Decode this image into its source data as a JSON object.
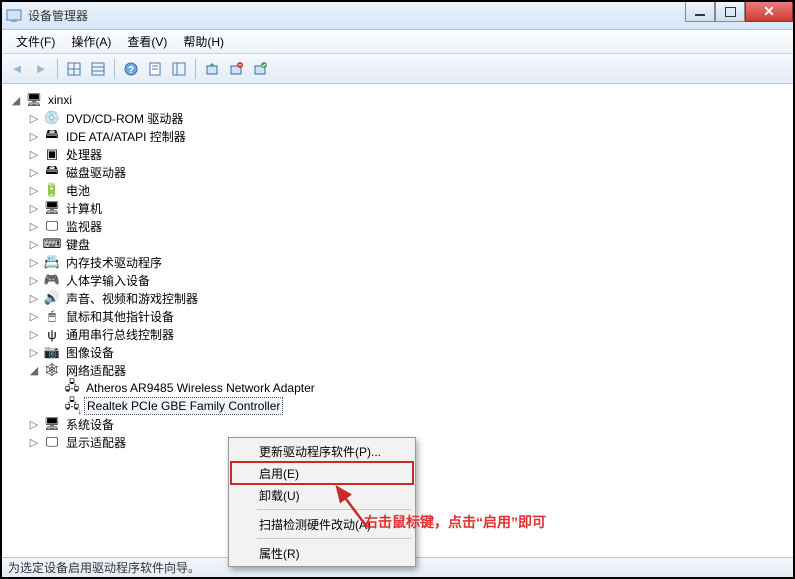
{
  "window": {
    "title": "设备管理器"
  },
  "menus": [
    {
      "label": "文件(F)"
    },
    {
      "label": "操作(A)"
    },
    {
      "label": "查看(V)"
    },
    {
      "label": "帮助(H)"
    }
  ],
  "root": {
    "name": "xinxi"
  },
  "categories": [
    {
      "label": "DVD/CD-ROM 驱动器",
      "icon": "💿",
      "expandable": true
    },
    {
      "label": "IDE ATA/ATAPI 控制器",
      "icon": "🖴",
      "expandable": true
    },
    {
      "label": "处理器",
      "icon": "▣",
      "expandable": true
    },
    {
      "label": "磁盘驱动器",
      "icon": "🖴",
      "expandable": true
    },
    {
      "label": "电池",
      "icon": "🔋",
      "expandable": true
    },
    {
      "label": "计算机",
      "icon": "🖥",
      "expandable": true
    },
    {
      "label": "监视器",
      "icon": "🖵",
      "expandable": true
    },
    {
      "label": "键盘",
      "icon": "⌨",
      "expandable": true
    },
    {
      "label": "内存技术驱动程序",
      "icon": "📇",
      "expandable": true
    },
    {
      "label": "人体学输入设备",
      "icon": "🎮",
      "expandable": true
    },
    {
      "label": "声音、视频和游戏控制器",
      "icon": "🔊",
      "expandable": true
    },
    {
      "label": "鼠标和其他指针设备",
      "icon": "🖱",
      "expandable": true
    },
    {
      "label": "通用串行总线控制器",
      "icon": "ψ",
      "expandable": true
    },
    {
      "label": "图像设备",
      "icon": "📷",
      "expandable": true
    }
  ],
  "network": {
    "label": "网络适配器",
    "icon": "🕸",
    "children": [
      {
        "label": "Atheros AR9485 Wireless Network Adapter",
        "icon": "🖧"
      },
      {
        "label": "Realtek PCIe GBE Family Controller",
        "icon": "🖧",
        "selected": true,
        "disabled": true
      }
    ]
  },
  "tail_categories": [
    {
      "label": "系统设备",
      "icon": "🖥",
      "expandable": true
    },
    {
      "label": "显示适配器",
      "icon": "🖵",
      "expandable": true
    }
  ],
  "context_menu": [
    {
      "label": "更新驱动程序软件(P)...",
      "type": "item"
    },
    {
      "label": "启用(E)",
      "type": "item",
      "boxed": true
    },
    {
      "label": "卸载(U)",
      "type": "item"
    },
    {
      "type": "sep"
    },
    {
      "label": "扫描检测硬件改动(A)",
      "type": "item"
    },
    {
      "type": "sep"
    },
    {
      "label": "属性(R)",
      "type": "item"
    }
  ],
  "annotation": "右击鼠标键，点击“启用”即可",
  "statusbar": "为选定设备启用驱动程序软件向导。"
}
